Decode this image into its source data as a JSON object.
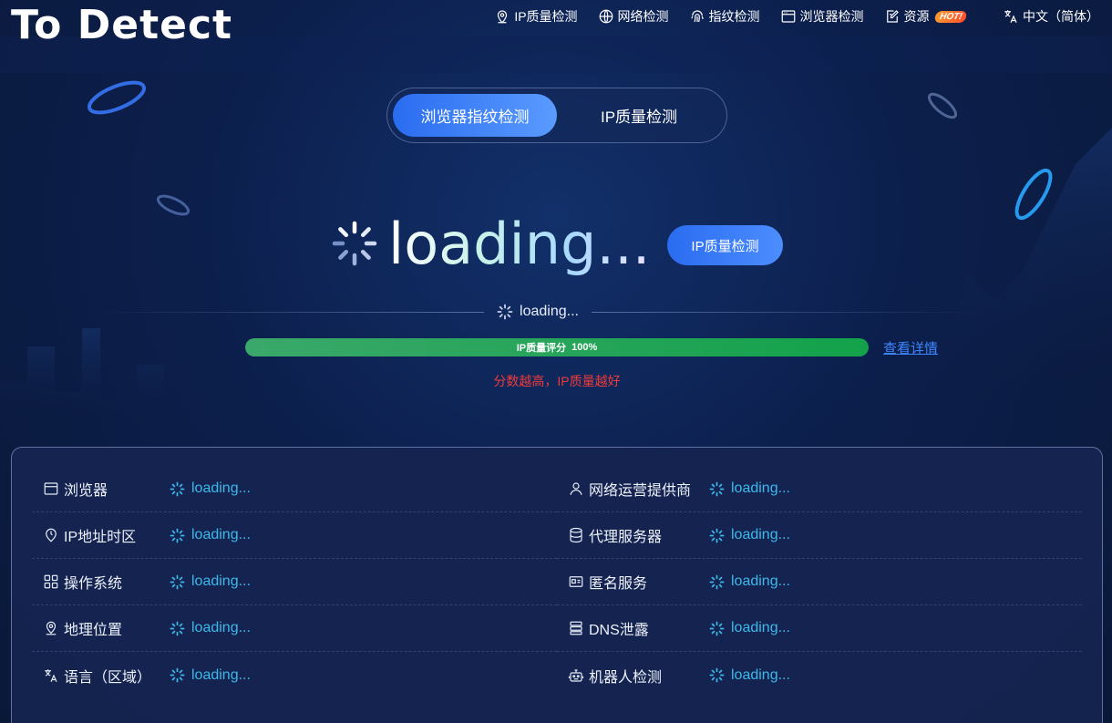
{
  "brand": {
    "logo_text_a": "To",
    "logo_text_b": "Detect",
    "accent_color": "#27c3f0"
  },
  "nav": {
    "items": [
      {
        "label": "IP质量检测",
        "icon": "map-pin-icon"
      },
      {
        "label": "网络检测",
        "icon": "globe-icon"
      },
      {
        "label": "指纹检测",
        "icon": "fingerprint-icon"
      },
      {
        "label": "浏览器检测",
        "icon": "browser-window-icon"
      },
      {
        "label": "资源",
        "icon": "edit-doc-icon",
        "badge": "HOT!"
      },
      {
        "label": "中文（简体）",
        "icon": "translate-icon"
      }
    ]
  },
  "tabs": [
    {
      "label": "浏览器指纹检测",
      "active": true
    },
    {
      "label": "IP质量检测",
      "active": false
    }
  ],
  "main": {
    "loading_big": "loading...",
    "ip_quality_button": "IP质量检测",
    "loading_small": "loading...",
    "progress": {
      "label": "IP质量评分",
      "percent_text": "100%",
      "value": 1.0,
      "color": "#13a24a"
    },
    "details_link": "查看详情",
    "hint": "分数越高，IP质量越好",
    "hint_color": "#ef3b3b"
  },
  "panel": {
    "left": [
      {
        "label": "浏览器",
        "icon": "browser-window-icon",
        "value": "loading..."
      },
      {
        "label": "IP地址时区",
        "icon": "clock-pin-icon",
        "value": "loading..."
      },
      {
        "label": "操作系统",
        "icon": "grid-apps-icon",
        "value": "loading..."
      },
      {
        "label": "地理位置",
        "icon": "map-pin-icon",
        "value": "loading..."
      },
      {
        "label": "语言（区域）",
        "icon": "translate-icon",
        "value": "loading..."
      }
    ],
    "right": [
      {
        "label": "网络运营提供商",
        "icon": "user-icon",
        "value": "loading..."
      },
      {
        "label": "代理服务器",
        "icon": "database-icon",
        "value": "loading..."
      },
      {
        "label": "匿名服务",
        "icon": "id-card-icon",
        "value": "loading..."
      },
      {
        "label": "DNS泄露",
        "icon": "server-stack-icon",
        "value": "loading..."
      },
      {
        "label": "机器人检测",
        "icon": "robot-icon",
        "value": "loading..."
      }
    ],
    "value_color": "#3cb9ec"
  }
}
